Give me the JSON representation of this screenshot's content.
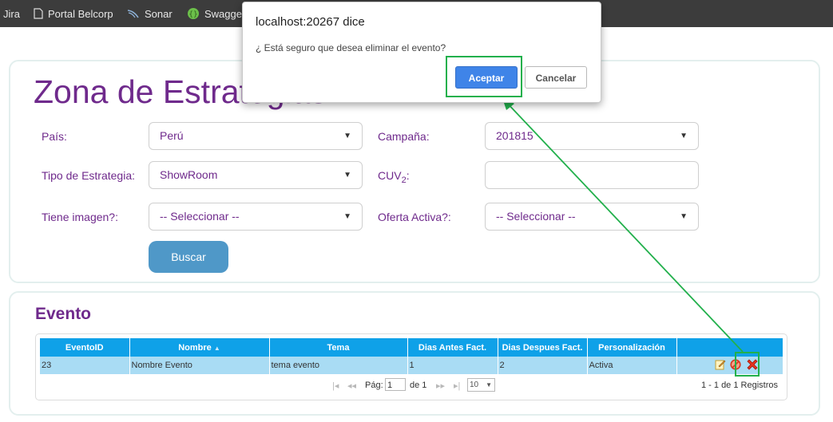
{
  "bookmarks": {
    "items": [
      {
        "label": "Jira",
        "icon": "jira-icon"
      },
      {
        "label": "Portal Belcorp",
        "icon": "page-icon"
      },
      {
        "label": "Sonar",
        "icon": "sonar-icon"
      },
      {
        "label": "Swagger",
        "icon": "swagger-icon"
      }
    ]
  },
  "dialog": {
    "title": "localhost:20267 dice",
    "message": "¿ Está seguro que desea eliminar el evento?",
    "ok_label": "Aceptar",
    "cancel_label": "Cancelar"
  },
  "filters": {
    "title": "Zona de Estrategias",
    "pais_label": "País:",
    "pais_value": "Perú",
    "campania_label": "Campaña:",
    "campania_value": "201815",
    "tipo_label": "Tipo de Estrategia:",
    "tipo_value": "ShowRoom",
    "cuv_label": "CUV",
    "cuv_sub": "2",
    "cuv_suffix": ":",
    "cuv_value": "",
    "imagen_label": "Tiene imagen?:",
    "imagen_value": "-- Seleccionar --",
    "oferta_label": "Oferta Activa?:",
    "oferta_value": "-- Seleccionar --",
    "buscar_label": "Buscar"
  },
  "evento": {
    "title": "Evento",
    "columns": [
      "EventoID",
      "Nombre",
      "Tema",
      "Dias Antes Fact.",
      "Dias Despues Fact.",
      "Personalización",
      ""
    ],
    "rows": [
      {
        "id": "23",
        "nombre": "Nombre Evento",
        "tema": "tema evento",
        "antes": "1",
        "despues": "2",
        "personalizacion": "Activa"
      }
    ],
    "pager": {
      "page_label": "Pág:",
      "page_value": "1",
      "of_label": "de 1",
      "page_size": "10",
      "records": "1 - 1 de 1 Registros"
    }
  },
  "colors": {
    "purple": "#6f2a8c",
    "header_blue": "#0fa1e8",
    "row_blue": "#a9dcf4",
    "highlight_green": "#22b04c",
    "accept_blue": "#3f84e8"
  }
}
